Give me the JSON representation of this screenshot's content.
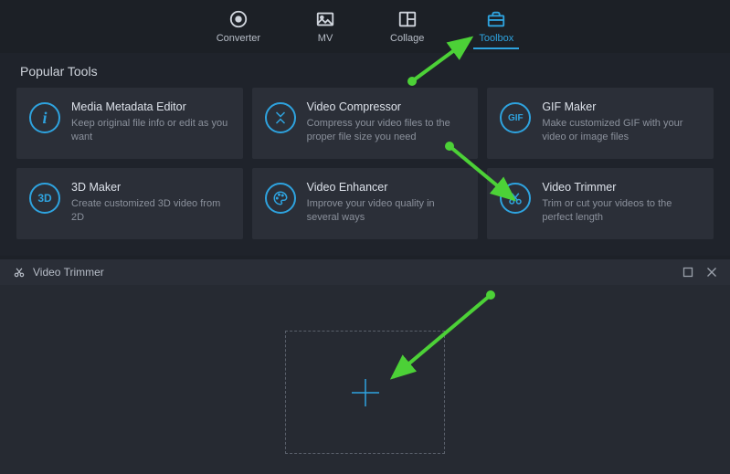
{
  "nav": {
    "items": [
      {
        "label": "Converter",
        "icon": "bullseye-icon"
      },
      {
        "label": "MV",
        "icon": "image-icon"
      },
      {
        "label": "Collage",
        "icon": "grid-icon"
      },
      {
        "label": "Toolbox",
        "icon": "toolbox-icon"
      }
    ],
    "active_index": 3
  },
  "section_title": "Popular Tools",
  "tools": [
    {
      "title": "Media Metadata Editor",
      "desc": "Keep original file info or edit as you want",
      "icon_text": "i",
      "icon_name": "info-icon"
    },
    {
      "title": "Video Compressor",
      "desc": "Compress your video files to the proper file size you need",
      "icon_text": "⇣",
      "icon_name": "compress-icon"
    },
    {
      "title": "GIF Maker",
      "desc": "Make customized GIF with your video or image files",
      "icon_text": "GIF",
      "icon_name": "gif-icon"
    },
    {
      "title": "3D Maker",
      "desc": "Create customized 3D video from 2D",
      "icon_text": "3D",
      "icon_name": "3d-icon"
    },
    {
      "title": "Video Enhancer",
      "desc": "Improve your video quality in several ways",
      "icon_text": "",
      "icon_name": "palette-icon"
    },
    {
      "title": "Video Trimmer",
      "desc": "Trim or cut your videos to the perfect length",
      "icon_text": "",
      "icon_name": "scissors-icon"
    }
  ],
  "trimmer": {
    "window_title": "Video Trimmer"
  },
  "accent_color": "#2ea3df",
  "annotation_color": "#4cd137"
}
